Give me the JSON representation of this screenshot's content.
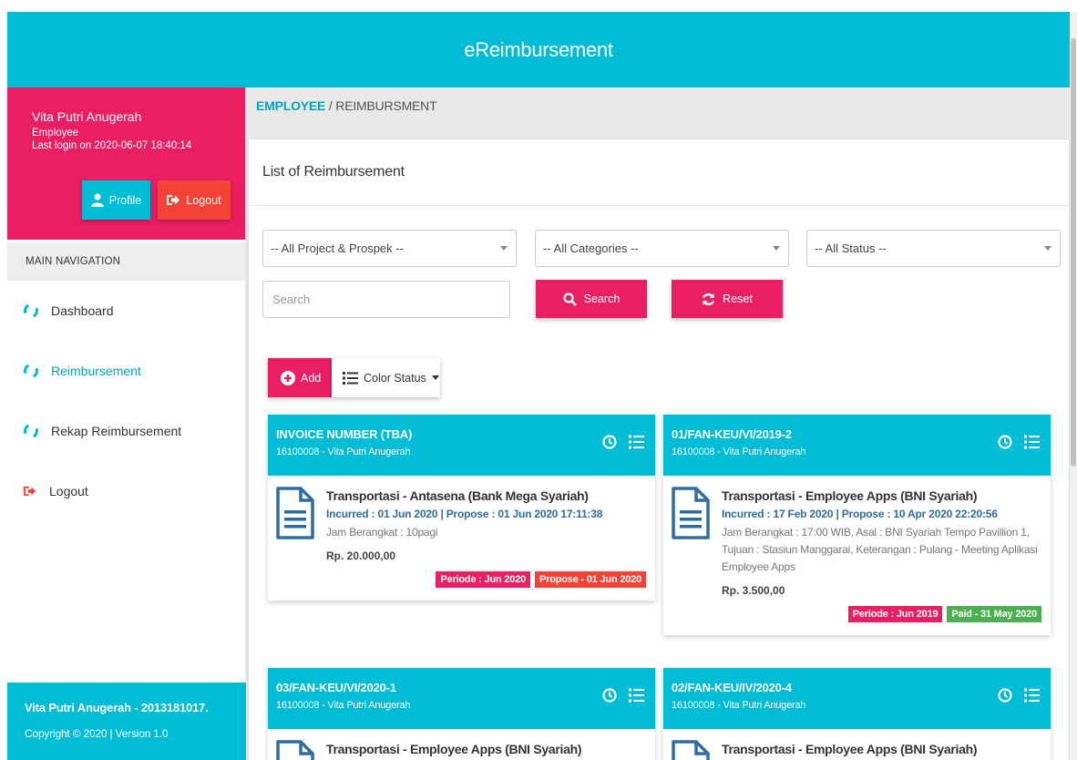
{
  "header": {
    "title": "eReimbursement"
  },
  "user": {
    "name": "Vita Putri Anugerah",
    "role": "Employee",
    "last_login": "Last login on 2020-06-07 18:40:14",
    "profile_label": "Profile",
    "logout_label": "Logout"
  },
  "nav": {
    "heading": "MAIN NAVIGATION",
    "items": [
      {
        "label": "Dashboard"
      },
      {
        "label": "Reimbursement"
      },
      {
        "label": "Rekap Reimbursement"
      },
      {
        "label": "Logout"
      }
    ]
  },
  "footer": {
    "line1": "Vita Putri Anugerah - 2013181017.",
    "line2": "Copyright © 2020 | Version 1.0"
  },
  "breadcrumb": {
    "section": "EMPLOYEE",
    "separator": " / ",
    "page": "REIMBURSMENT"
  },
  "panel": {
    "title": "List of Reimbursement",
    "filters": {
      "project": "-- All Project & Prospek --",
      "category": "-- All Categories --",
      "status": "-- All Status --"
    },
    "search_placeholder": "Search",
    "search_label": "Search",
    "reset_label": "Reset",
    "add_label": "Add",
    "color_status_label": "Color Status"
  },
  "colors": {
    "primary": "#00bcd4",
    "accent": "#e91e63",
    "danger": "#f44336",
    "success": "#4caf50"
  },
  "reimbursements": [
    {
      "invoice": "INVOICE NUMBER (TBA)",
      "employee": "16100008 - Vita Putri Anugerah",
      "title": "Transportasi - Antasena (Bank Mega Syariah)",
      "dates": "Incurred : 01 Jun 2020 | Propose : 01 Jun 2020 17:11:38",
      "desc": "Jam Berangkat : 10pagi",
      "amount": "Rp. 20.000,00",
      "period": "Periode : Jun 2020",
      "status": "Propose - 01 Jun 2020"
    },
    {
      "invoice": "01/FAN-KEU/VI/2019-2",
      "employee": "16100008 - Vita Putri Anugerah",
      "title": "Transportasi - Employee Apps (BNI Syariah)",
      "dates": "Incurred : 17 Feb 2020 | Propose : 10 Apr 2020 22:20:56",
      "desc": "Jam Berangkat : 17:00 WIB, Asal : BNI Syariah Tempo Pavillion 1, Tujuan : Stasiun Manggarai, Keterangan : Pulang - Meeting Aplikasi Employee Apps",
      "amount": "Rp. 3.500,00",
      "period": "Periode : Jun 2019",
      "status": "Paid - 31 May 2020"
    },
    {
      "invoice": "03/FAN-KEU/VI/2020-1",
      "employee": "16100008 - Vita Putri Anugerah",
      "title": "Transportasi - Employee Apps (BNI Syariah)"
    },
    {
      "invoice": "02/FAN-KEU/IV/2020-4",
      "employee": "16100008 - Vita Putri Anugerah",
      "title": "Transportasi - Employee Apps (BNI Syariah)"
    }
  ]
}
